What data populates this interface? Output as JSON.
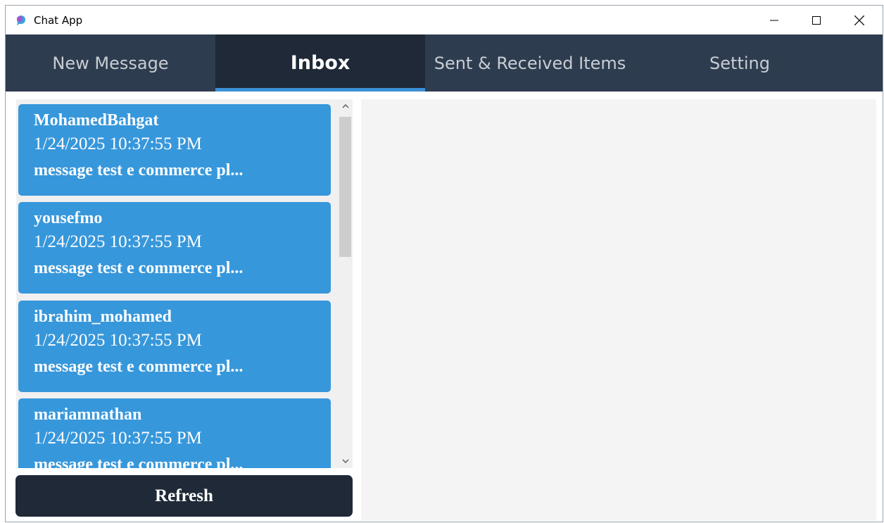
{
  "window": {
    "title": "Chat App"
  },
  "tabs": [
    {
      "label": "New Message",
      "active": false
    },
    {
      "label": "Inbox",
      "active": true
    },
    {
      "label": "Sent & Received Items",
      "active": false
    },
    {
      "label": "Setting",
      "active": false
    }
  ],
  "messages": [
    {
      "sender": "MohamedBahgat",
      "date": "1/24/2025 10:37:55 PM",
      "preview": "message test e commerce pl..."
    },
    {
      "sender": "yousefmo",
      "date": "1/24/2025 10:37:55 PM",
      "preview": "message test e commerce pl..."
    },
    {
      "sender": "ibrahim_mohamed",
      "date": "1/24/2025 10:37:55 PM",
      "preview": "message test e commerce pl..."
    },
    {
      "sender": "mariamnathan",
      "date": "1/24/2025 10:37:55 PM",
      "preview": "message test e commerce pl..."
    }
  ],
  "refresh_label": "Refresh",
  "colors": {
    "tabbar": "#2e3c4f",
    "tab_active": "#1f2937",
    "tab_indicator": "#3b8fd6",
    "card": "#3797db",
    "button": "#1f2937"
  }
}
